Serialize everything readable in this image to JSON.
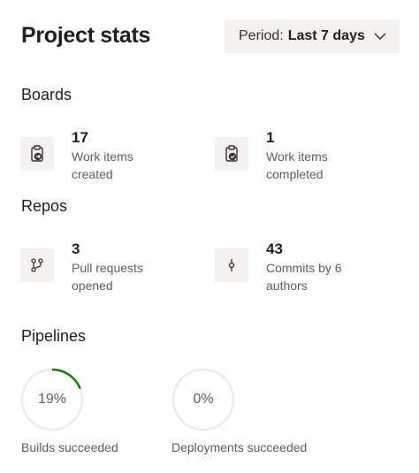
{
  "header": {
    "title": "Project stats",
    "period_label": "Period:",
    "period_value": "Last 7 days"
  },
  "boards": {
    "title": "Boards",
    "stats": [
      {
        "value": "17",
        "line1": "Work items",
        "line2": "created",
        "icon": "clipboard-arrow-icon"
      },
      {
        "value": "1",
        "line1": "Work items",
        "line2": "completed",
        "icon": "clipboard-check-icon"
      }
    ]
  },
  "repos": {
    "title": "Repos",
    "stats": [
      {
        "value": "3",
        "line1": "Pull requests",
        "line2": "opened",
        "icon": "pull-request-icon"
      },
      {
        "value": "43",
        "line1": "Commits by 6",
        "line2": "authors",
        "icon": "commit-icon"
      }
    ]
  },
  "pipelines": {
    "title": "Pipelines",
    "rings": [
      {
        "percent_text": "19%",
        "fraction": 0.19,
        "label": "Builds succeeded"
      },
      {
        "percent_text": "0%",
        "fraction": 0.0,
        "label": "Deployments succeeded"
      }
    ]
  },
  "colors": {
    "ring_track": "#edebe9",
    "ring_fill": "#107c10",
    "tile_bg": "#f3f2f1"
  }
}
